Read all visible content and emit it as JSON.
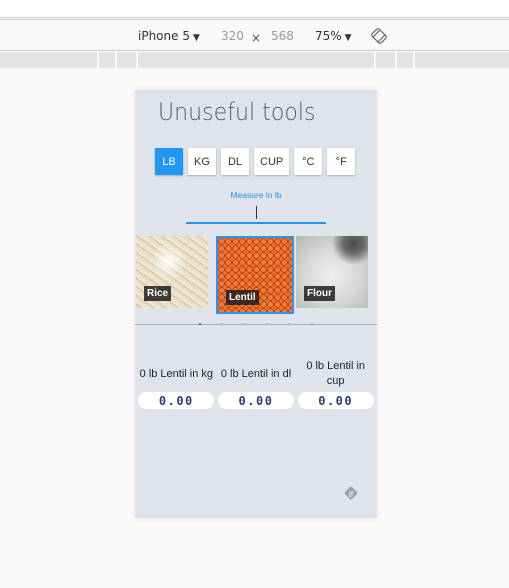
{
  "devtools": {
    "device": "iPhone 5",
    "width": "320",
    "times": "×",
    "height": "568",
    "zoom": "75%",
    "caret": "▼"
  },
  "app": {
    "title": "Unuseful tools",
    "units": [
      {
        "label": "LB",
        "active": true
      },
      {
        "label": "KG",
        "active": false
      },
      {
        "label": "DL",
        "active": false
      },
      {
        "label": "CUP",
        "active": false
      },
      {
        "label": "°C",
        "active": false
      },
      {
        "label": "°F",
        "active": false
      }
    ],
    "measure_label": "Measure in lb",
    "measure_value": "",
    "foods": [
      {
        "label": "Rice",
        "selected": false
      },
      {
        "label": "Lentil",
        "selected": true
      },
      {
        "label": "Flour",
        "selected": false
      }
    ],
    "results": [
      {
        "label": "0 lb Lentil in kg",
        "value": "0.00"
      },
      {
        "label": "0 lb Lentil in dl",
        "value": "0.00"
      },
      {
        "label": "0 lb Lentil in cup",
        "value": "0.00"
      }
    ],
    "colors": {
      "accent": "#2196f3",
      "background": "#dfe3eb",
      "value_text": "#2c3e70"
    }
  }
}
